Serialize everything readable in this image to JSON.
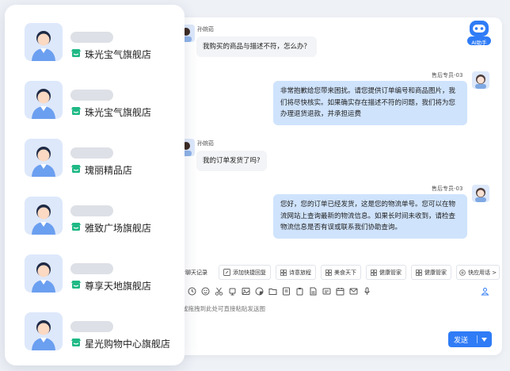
{
  "stores": [
    {
      "name": "珠光宝气旗舰店"
    },
    {
      "name": "珠光宝气旗舰店"
    },
    {
      "name": "瑰丽精品店"
    },
    {
      "name": "雅致广场旗舰店"
    },
    {
      "name": "尊享天地旗舰店"
    },
    {
      "name": "星光购物中心旗舰店"
    }
  ],
  "messages": {
    "m1": {
      "sender": "孙婉茹",
      "text": "我购买的商品与描述不符，怎么办？"
    },
    "m2": {
      "sender": "售后专员-03",
      "lines": [
        "非常抱歉给您带来困扰。请您提供订单编号和商品图片，我",
        "们将尽快核实。如果确实存在描述不符的问题，我们将为您",
        "办理退货退款，并承担运费"
      ]
    },
    "m3": {
      "sender": "孙婉茹",
      "text": "我的订单发货了吗?"
    },
    "m4": {
      "sender": "售后专员-03",
      "lines": [
        "您好，您的订单已经发货，这是您的物流单号。您可以在物",
        "流网站上查询最新的物流信息。如果长时间未收到，请检查",
        "物流信息是否有误或联系我们协助查询。"
      ]
    }
  },
  "quick": {
    "history": "看聊天记录",
    "add": "添加快捷回复",
    "chips": [
      "诗意旅程",
      "美食天下",
      "健康管家",
      "健康管家"
    ],
    "more": "快应用话 >"
  },
  "input": {
    "placeholder": "或拖拽到此处可直接粘贴发送图"
  },
  "send": {
    "label": "发送"
  },
  "ai": {
    "label": "AI助手"
  },
  "colors": {
    "accent": "#2f7cf6",
    "agent_bubble": "#cfe3fc",
    "user_bubble": "#f3f4f7",
    "store_icon": "#1fb985"
  }
}
